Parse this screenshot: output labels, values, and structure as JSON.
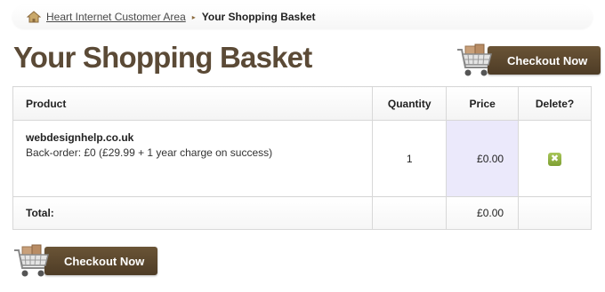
{
  "breadcrumb": {
    "home_label": "Heart Internet Customer Area",
    "separator": "▸",
    "current": "Your Shopping Basket"
  },
  "page": {
    "title": "Your Shopping Basket"
  },
  "checkout": {
    "label": "Checkout Now"
  },
  "table": {
    "headers": {
      "product": "Product",
      "quantity": "Quantity",
      "price": "Price",
      "delete": "Delete?"
    },
    "items": [
      {
        "name": "webdesignhelp.co.uk",
        "description": "Back-order: £0 (£29.99 + 1 year charge on success)",
        "quantity": "1",
        "price": "£0.00",
        "delete_icon": "✖"
      }
    ],
    "total_label": "Total:",
    "total_price": "£0.00"
  },
  "colors": {
    "brand_brown": "#5b4a36",
    "button_brown": "#5c4830",
    "price_highlight": "#ebe9fb",
    "delete_green": "#8fb03f"
  }
}
